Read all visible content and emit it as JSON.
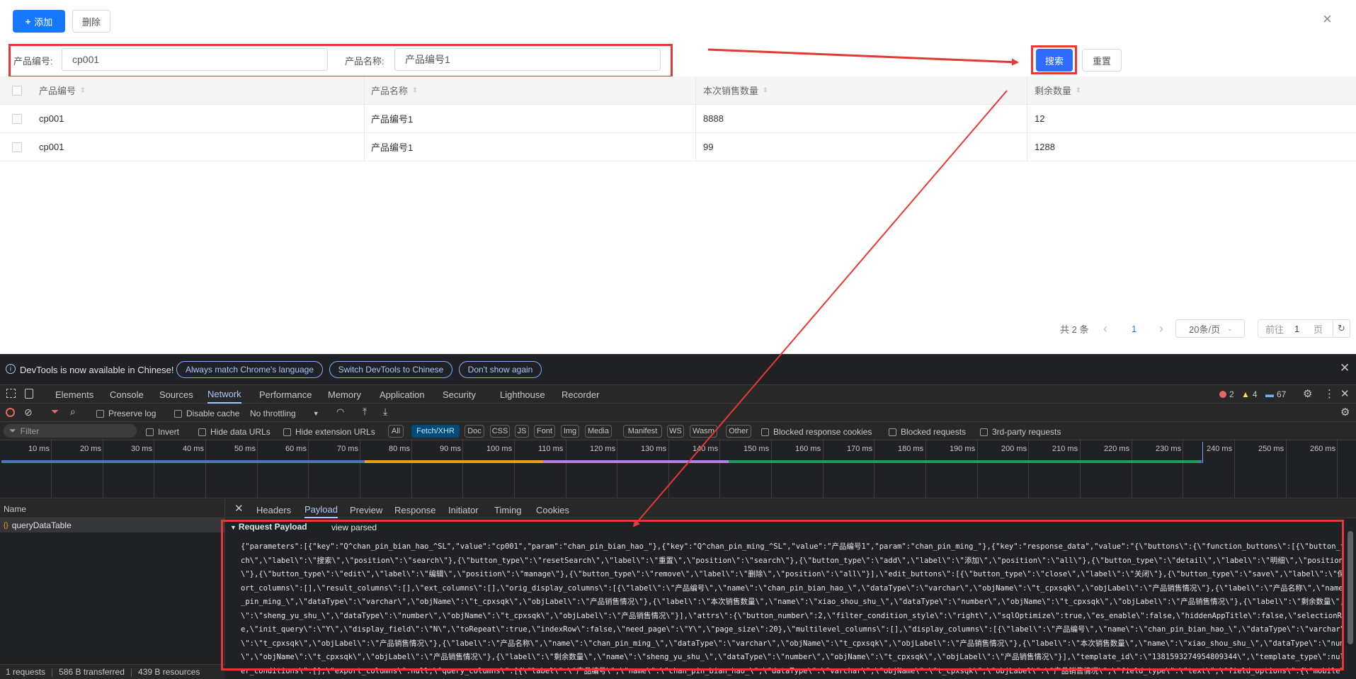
{
  "toolbar": {
    "add_label": "添加",
    "add_plus": "+",
    "delete_label": "删除",
    "close_glyph": "×"
  },
  "search": {
    "code_label": "产品编号:",
    "code_value": "cp001",
    "name_label": "产品名称:",
    "name_value": "产品编号1",
    "search_button": "搜索",
    "reset_button": "重置"
  },
  "table": {
    "columns": [
      "产品编号",
      "产品名称",
      "本次销售数量",
      "剩余数量"
    ],
    "sort_glyph": "⇕",
    "rows": [
      [
        "cp001",
        "产品编号1",
        "8888",
        "12"
      ],
      [
        "cp001",
        "产品编号1",
        "99",
        "1288"
      ]
    ]
  },
  "pagination": {
    "total": "共 2 条",
    "current": "1",
    "page_size": "20条/页",
    "goto_prefix": "前往",
    "goto_value": "1",
    "goto_suffix": "页",
    "prev_glyph": "‹",
    "next_glyph": "›",
    "refresh_glyph": "↻"
  },
  "devtools": {
    "banner": {
      "message": "DevTools is now available in Chinese!",
      "btn_match": "Always match Chrome's language",
      "btn_switch": "Switch DevTools to Chinese",
      "btn_dismiss": "Don't show again"
    },
    "tabs": [
      "Elements",
      "Console",
      "Sources",
      "Network",
      "Performance",
      "Memory",
      "Application",
      "Security",
      "Lighthouse",
      "Recorder"
    ],
    "badges": {
      "errors": "2",
      "warnings": "4",
      "messages": "67"
    },
    "network_toolbar": {
      "preserve_log": "Preserve log",
      "disable_cache": "Disable cache",
      "throttling": "No throttling"
    },
    "filter_bar": {
      "placeholder": "Filter",
      "invert": "Invert",
      "hide_data_urls": "Hide data URLs",
      "hide_ext_urls": "Hide extension URLs",
      "types": [
        "All",
        "Fetch/XHR",
        "Doc",
        "CSS",
        "JS",
        "Font",
        "Img",
        "Media",
        "Manifest",
        "WS",
        "Wasm",
        "Other"
      ],
      "active_type": "Fetch/XHR",
      "blocked_cookies": "Blocked response cookies",
      "blocked_requests": "Blocked requests",
      "third_party": "3rd-party requests"
    },
    "timeline_ticks": [
      "10 ms",
      "20 ms",
      "30 ms",
      "40 ms",
      "50 ms",
      "60 ms",
      "70 ms",
      "80 ms",
      "90 ms",
      "100 ms",
      "110 ms",
      "120 ms",
      "130 ms",
      "140 ms",
      "150 ms",
      "160 ms",
      "170 ms",
      "180 ms",
      "190 ms",
      "200 ms",
      "210 ms",
      "220 ms",
      "230 ms",
      "240 ms",
      "250 ms",
      "260 ms"
    ],
    "name_header": "Name",
    "request_name": "queryDataTable",
    "detail_tabs": [
      "Headers",
      "Payload",
      "Preview",
      "Response",
      "Initiator",
      "Timing",
      "Cookies"
    ],
    "payload_section": "Request Payload",
    "view_parsed": "view parsed",
    "payload_lines": [
      "{\"parameters\":[{\"key\":\"Q^chan_pin_bian_hao_^SL\",\"value\":\"cp001\",\"param\":\"chan_pin_bian_hao_\"},{\"key\":\"Q^chan_pin_ming_^SL\",\"value\":\"产品编号1\",\"param\":\"chan_pin_ming_\"},{\"key\":\"response_data\",\"value\":\"{\\\"buttons\\\":{\\\"function_buttons\\\":[{\\\"button_type\\\":\\\"sear",
      "ch\\\",\\\"label\\\":\\\"搜索\\\",\\\"position\\\":\\\"search\\\"},{\\\"button_type\\\":\\\"resetSearch\\\",\\\"label\\\":\\\"重置\\\",\\\"position\\\":\\\"search\\\"},{\\\"button_type\\\":\\\"add\\\",\\\"label\\\":\\\"添加\\\",\\\"position\\\":\\\"all\\\"},{\\\"button_type\\\":\\\"detail\\\",\\\"label\\\":\\\"明细\\\",\\\"position\\\":\\\"manage",
      "\\\"},{\\\"button_type\\\":\\\"edit\\\",\\\"label\\\":\\\"编辑\\\",\\\"position\\\":\\\"manage\\\"},{\\\"button_type\\\":\\\"remove\\\",\\\"label\\\":\\\"删除\\\",\\\"position\\\":\\\"all\\\"}],\\\"edit_buttons\\\":[{\\\"button_type\\\":\\\"close\\\",\\\"label\\\":\\\"关闭\\\"},{\\\"button_type\\\":\\\"save\\\",\\\"label\\\":\\\"保存\\\"}]},\\\"s",
      "ort_columns\\\":[],\\\"result_columns\\\":[],\\\"ext_columns\\\":[],\\\"orig_display_columns\\\":[{\\\"label\\\":\\\"产品编号\\\",\\\"name\\\":\\\"chan_pin_bian_hao_\\\",\\\"dataType\\\":\\\"varchar\\\",\\\"objName\\\":\\\"t_cpxsqk\\\",\\\"objLabel\\\":\\\"产品销售情况\\\"},{\\\"label\\\":\\\"产品名称\\\",\\\"name\\\":\\\"cha",
      "_pin_ming_\\\",\\\"dataType\\\":\\\"varchar\\\",\\\"objName\\\":\\\"t_cpxsqk\\\",\\\"objLabel\\\":\\\"产品销售情况\\\"},{\\\"label\\\":\\\"本次销售数量\\\",\\\"name\\\":\\\"xiao_shou_shu_\\\",\\\"dataType\\\":\\\"number\\\",\\\"objName\\\":\\\"t_cpxsqk\\\",\\\"objLabel\\\":\\\"产品销售情况\\\"},{\\\"label\\\":\\\"剩余数量\\\",\\\"name",
      "\\\":\\\"sheng_yu_shu_\\\",\\\"dataType\\\":\\\"number\\\",\\\"objName\\\":\\\"t_cpxsqk\\\",\\\"objLabel\\\":\\\"产品销售情况\\\"}],\\\"attrs\\\":{\\\"button_number\\\":2,\\\"filter_condition_style\\\":\\\"right\\\",\\\"sqlOptimize\\\":true,\\\"es_enable\\\":false,\\\"hiddenAppTitle\\\":false,\\\"selectionRow\\\":tru",
      "e,\\\"init_query\\\":\\\"Y\\\",\\\"display_field\\\":\\\"N\\\",\\\"toRepeat\\\":true,\\\"indexRow\\\":false,\\\"need_page\\\":\\\"Y\\\",\\\"page_size\\\":20},\\\"multilevel_columns\\\":[],\\\"display_columns\\\":[{\\\"label\\\":\\\"产品编号\\\",\\\"name\\\":\\\"chan_pin_bian_hao_\\\",\\\"dataType\\\":\\\"varchar\\\",\\\"objName",
      "\\\":\\\"t_cpxsqk\\\",\\\"objLabel\\\":\\\"产品销售情况\\\"},{\\\"label\\\":\\\"产品名称\\\",\\\"name\\\":\\\"chan_pin_ming_\\\",\\\"dataType\\\":\\\"varchar\\\",\\\"objName\\\":\\\"t_cpxsqk\\\",\\\"objLabel\\\":\\\"产品销售情况\\\"},{\\\"label\\\":\\\"本次销售数量\\\",\\\"name\\\":\\\"xiao_shou_shu_\\\",\\\"dataType\\\":\\\"number",
      "\\\",\\\"objName\\\":\\\"t_cpxsqk\\\",\\\"objLabel\\\":\\\"产品销售情况\\\"},{\\\"label\\\":\\\"剩余数量\\\",\\\"name\\\":\\\"sheng_yu_shu_\\\",\\\"dataType\\\":\\\"number\\\",\\\"objName\\\":\\\"t_cpxsqk\\\",\\\"objLabel\\\":\\\"产品销售情况\\\"}],\\\"template_id\\\":\\\"1381593274954809344\\\",\\\"template_type\\\":null,\\\"fil",
      "er_conditions\\\":[],\\\"export_columns\\\":null,\\\"query_columns\\\":[{\\\"label\\\":\\\"产品编号\\\",\\\"name\\\":\\\"chan_pin_bian_hao_\\\",\\\"dataType\\\":\\\"varchar\\\",\\\"objName\\\":\\\"t_cpxsqk\\\",\\\"objLabel\\\":\\\"产品销售情况\\\",\\\"field_type\\\":\\\"text\\\",\\\"field_options\\\":{\\\"mobile\\\":true,\\\"ve"
    ],
    "status": {
      "requests": "1 requests",
      "transferred": "586 B transferred",
      "resources": "439 B resources"
    }
  },
  "colors": {
    "primary": "#1677ff",
    "annotation": "#e53935",
    "devtools_bg": "#202124",
    "devtools_accent": "#a8c7fa"
  }
}
